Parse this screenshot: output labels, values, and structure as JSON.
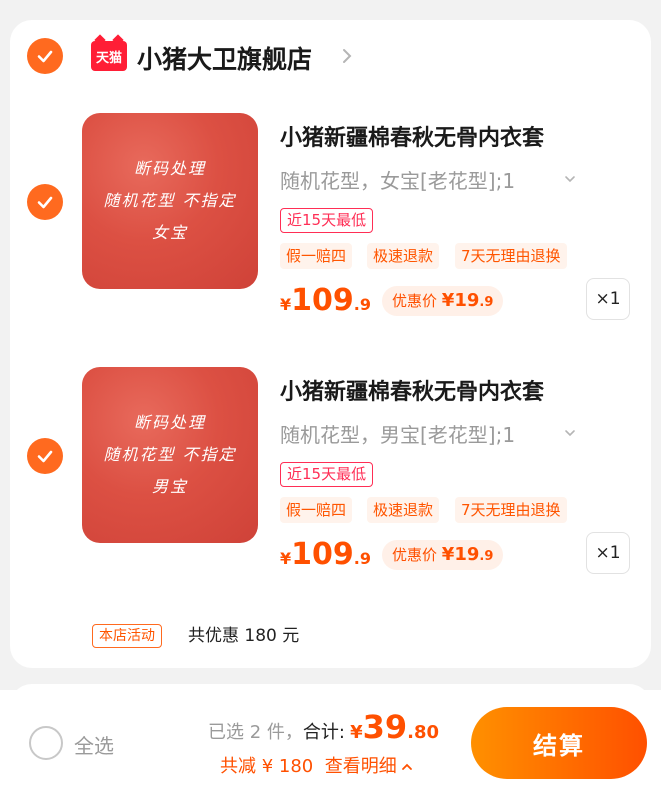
{
  "colors": {
    "accent": "#ff5000",
    "check": "#ff6a1f",
    "tmall": "#ff1e36",
    "thumb": "#dc5043"
  },
  "shop": {
    "logo_text": "天猫",
    "name": "小猪大卫旗舰店",
    "chevron_icon": "chevron-right-icon",
    "selected": true
  },
  "items": [
    {
      "selected": true,
      "thumb_lines": [
        "断码处理",
        "随机花型 不指定",
        "女宝"
      ],
      "title": "小猪新疆棉春秋无骨内衣套",
      "spec": "随机花型，女宝[老花型];1",
      "lowest_badge": "近15天最低",
      "tags": [
        "假一赔四",
        "极速退款",
        "7天无理由退换"
      ],
      "price_currency": "¥",
      "price_int": "109",
      "price_dec": ".9",
      "promo_label": "优惠价",
      "promo_currency": "¥",
      "promo_int": "19",
      "promo_dec": ".9",
      "quantity": "×1"
    },
    {
      "selected": true,
      "thumb_lines": [
        "断码处理",
        "随机花型 不指定",
        "男宝"
      ],
      "title": "小猪新疆棉春秋无骨内衣套",
      "spec": "随机花型，男宝[老花型];1",
      "lowest_badge": "近15天最低",
      "tags": [
        "假一赔四",
        "极速退款",
        "7天无理由退换"
      ],
      "price_currency": "¥",
      "price_int": "109",
      "price_dec": ".9",
      "promo_label": "优惠价",
      "promo_currency": "¥",
      "promo_int": "19",
      "promo_dec": ".9",
      "quantity": "×1"
    }
  ],
  "activity": {
    "tag": "本店活动",
    "text": "共优惠 180 元"
  },
  "footer": {
    "select_all": "全选",
    "selected_count": "已选 2 件，",
    "total_label": "合计:",
    "total_currency": "¥",
    "total_int": "39",
    "total_dec": ".80",
    "saving": "共减 ¥ 180",
    "detail_link": "查看明细",
    "checkout": "结算"
  }
}
